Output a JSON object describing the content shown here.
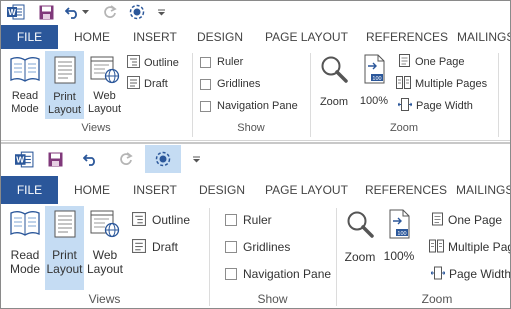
{
  "quick_access": {
    "items": [
      {
        "name": "word-app-icon"
      },
      {
        "name": "save-icon"
      },
      {
        "name": "undo-icon"
      },
      {
        "name": "undo-dropdown-icon"
      },
      {
        "name": "redo-icon"
      },
      {
        "name": "touch-mode-icon"
      },
      {
        "name": "customize-qat-icon"
      }
    ]
  },
  "tabs": [
    {
      "label": "FILE",
      "active": true
    },
    {
      "label": "HOME"
    },
    {
      "label": "INSERT"
    },
    {
      "label": "DESIGN"
    },
    {
      "label": "PAGE LAYOUT"
    },
    {
      "label": "REFERENCES"
    },
    {
      "label": "MAILINGS"
    }
  ],
  "views_group": {
    "label": "Views",
    "buttons": {
      "read_mode": "Read\nMode",
      "print_layout": "Print\nLayout",
      "web_layout": "Web\nLayout"
    },
    "outline": "Outline",
    "draft": "Draft"
  },
  "show_group": {
    "label": "Show",
    "ruler": "Ruler",
    "gridlines": "Gridlines",
    "navigation_pane": "Navigation Pane"
  },
  "zoom_group": {
    "label": "Zoom",
    "zoom": "Zoom",
    "hundred": "100%",
    "one_page": "One Page",
    "multiple_pages": "Multiple Pages",
    "page_width": "Page Width"
  },
  "colors": {
    "file_tab": "#2b579a",
    "active_view": "#c5dcf3",
    "word_blue": "#2b579a",
    "save_purple": "#80397b"
  }
}
